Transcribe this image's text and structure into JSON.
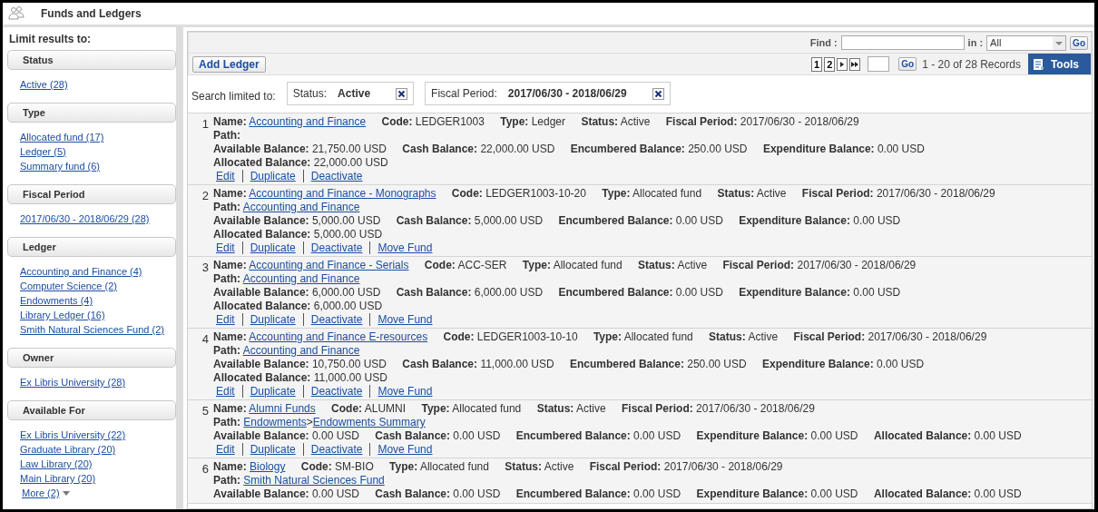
{
  "header": {
    "title": "Funds and Ledgers"
  },
  "sidebar": {
    "heading": "Limit results to:",
    "groups": [
      {
        "title": "Status",
        "items": [
          "Active (28)"
        ]
      },
      {
        "title": "Type",
        "items": [
          "Allocated fund (17)",
          "Ledger (5)",
          "Summary fund (6)"
        ]
      },
      {
        "title": "Fiscal Period",
        "items": [
          "2017/06/30 - 2018/06/29 (28)"
        ]
      },
      {
        "title": "Ledger",
        "items": [
          "Accounting and Finance (4)",
          "Computer Science (2)",
          "Endowments (4)",
          "Library Ledger (16)",
          "Smith Natural Sciences Fund (2)"
        ]
      },
      {
        "title": "Owner",
        "items": [
          "Ex Libris University (28)"
        ]
      },
      {
        "title": "Available For",
        "items": [
          "Ex Libris University (22)",
          "Graduate Library (20)",
          "Law Library (20)",
          "Main Library (20)"
        ]
      }
    ],
    "more": "More (2)"
  },
  "toolbar": {
    "find_label": "Find :",
    "in_label": "in :",
    "in_value": "All",
    "find_go": "Go",
    "add_button": "Add Ledger",
    "pages": [
      "1",
      "2"
    ],
    "page_go": "Go",
    "records": "1 - 20 of 28 Records",
    "tools": "Tools"
  },
  "filters": {
    "label": "Search limited to:",
    "chips": [
      {
        "label": "Status:",
        "value": "Active"
      },
      {
        "label": "Fiscal Period:",
        "value": "2017/06/30 - 2018/06/29"
      }
    ]
  },
  "records": [
    {
      "index": "1",
      "fields": [
        {
          "label": "Name:",
          "value": "Accounting and Finance",
          "kind": "link"
        },
        {
          "label": "Code:",
          "value": "LEDGER1003",
          "kind": "text"
        },
        {
          "label": "Type:",
          "value": "Ledger",
          "kind": "text"
        },
        {
          "label": "Status:",
          "value": "Active",
          "kind": "text"
        },
        {
          "label": "Fiscal Period:",
          "value": "2017/06/30 - 2018/06/29",
          "kind": "text"
        }
      ],
      "path_label": "Path:",
      "balances": [
        {
          "label": "Available Balance:",
          "value": "21,750.00 USD"
        },
        {
          "label": "Cash Balance:",
          "value": "22,000.00 USD"
        },
        {
          "label": "Encumbered Balance:",
          "value": "250.00 USD"
        },
        {
          "label": "Expenditure Balance:",
          "value": "0.00 USD"
        },
        {
          "label": "Allocated Balance:",
          "value": "22,000.00 USD"
        }
      ],
      "actions": [
        "Edit",
        "Duplicate",
        "Deactivate"
      ]
    },
    {
      "index": "2",
      "fields": [
        {
          "label": "Name:",
          "value": "Accounting and Finance - Monographs",
          "kind": "link"
        },
        {
          "label": "Code:",
          "value": "LEDGER1003-10-20",
          "kind": "text"
        },
        {
          "label": "Type:",
          "value": "Allocated fund",
          "kind": "text"
        },
        {
          "label": "Status:",
          "value": "Active",
          "kind": "text"
        },
        {
          "label": "Fiscal Period:",
          "value": "2017/06/30 - 2018/06/29",
          "kind": "text"
        }
      ],
      "path_label": "Path:",
      "path": [
        {
          "text": "Accounting and Finance",
          "kind": "link"
        }
      ],
      "balances": [
        {
          "label": "Available Balance:",
          "value": "5,000.00 USD"
        },
        {
          "label": "Cash Balance:",
          "value": "5,000.00 USD"
        },
        {
          "label": "Encumbered Balance:",
          "value": "0.00 USD"
        },
        {
          "label": "Expenditure Balance:",
          "value": "0.00 USD"
        },
        {
          "label": "Allocated Balance:",
          "value": "5,000.00 USD"
        }
      ],
      "actions": [
        "Edit",
        "Duplicate",
        "Deactivate",
        "Move Fund"
      ]
    },
    {
      "index": "3",
      "fields": [
        {
          "label": "Name:",
          "value": "Accounting and Finance - Serials",
          "kind": "link"
        },
        {
          "label": "Code:",
          "value": "ACC-SER",
          "kind": "text"
        },
        {
          "label": "Type:",
          "value": "Allocated fund",
          "kind": "text"
        },
        {
          "label": "Status:",
          "value": "Active",
          "kind": "text"
        },
        {
          "label": "Fiscal Period:",
          "value": "2017/06/30 - 2018/06/29",
          "kind": "text"
        }
      ],
      "path_label": "Path:",
      "path": [
        {
          "text": "Accounting and Finance",
          "kind": "link"
        }
      ],
      "balances": [
        {
          "label": "Available Balance:",
          "value": "6,000.00 USD"
        },
        {
          "label": "Cash Balance:",
          "value": "6,000.00 USD"
        },
        {
          "label": "Encumbered Balance:",
          "value": "0.00 USD"
        },
        {
          "label": "Expenditure Balance:",
          "value": "0.00 USD"
        },
        {
          "label": "Allocated Balance:",
          "value": "6,000.00 USD"
        }
      ],
      "actions": [
        "Edit",
        "Duplicate",
        "Deactivate",
        "Move Fund"
      ]
    },
    {
      "index": "4",
      "fields": [
        {
          "label": "Name:",
          "value": "Accounting and Finance E-resources",
          "kind": "link"
        },
        {
          "label": "Code:",
          "value": "LEDGER1003-10-10",
          "kind": "text"
        },
        {
          "label": "Type:",
          "value": "Allocated fund",
          "kind": "text"
        },
        {
          "label": "Status:",
          "value": "Active",
          "kind": "text"
        },
        {
          "label": "Fiscal Period:",
          "value": "2017/06/30 - 2018/06/29",
          "kind": "text"
        }
      ],
      "path_label": "Path:",
      "path": [
        {
          "text": "Accounting and Finance",
          "kind": "link"
        }
      ],
      "balances": [
        {
          "label": "Available Balance:",
          "value": "10,750.00 USD"
        },
        {
          "label": "Cash Balance:",
          "value": "11,000.00 USD"
        },
        {
          "label": "Encumbered Balance:",
          "value": "250.00 USD"
        },
        {
          "label": "Expenditure Balance:",
          "value": "0.00 USD"
        },
        {
          "label": "Allocated Balance:",
          "value": "11,000.00 USD"
        }
      ],
      "actions": [
        "Edit",
        "Duplicate",
        "Deactivate",
        "Move Fund"
      ]
    },
    {
      "index": "5",
      "fields": [
        {
          "label": "Name:",
          "value": "Alumni Funds",
          "kind": "link"
        },
        {
          "label": "Code:",
          "value": "ALUMNI",
          "kind": "text"
        },
        {
          "label": "Type:",
          "value": "Allocated fund",
          "kind": "text"
        },
        {
          "label": "Status:",
          "value": "Active",
          "kind": "text"
        },
        {
          "label": "Fiscal Period:",
          "value": "2017/06/30 - 2018/06/29",
          "kind": "text"
        }
      ],
      "path_label": "Path:",
      "path": [
        {
          "text": "Endowments",
          "kind": "link"
        },
        {
          "text": ">",
          "kind": "separator"
        },
        {
          "text": "Endowments Summary",
          "kind": "link"
        }
      ],
      "balances": [
        {
          "label": "Available Balance:",
          "value": "0.00 USD"
        },
        {
          "label": "Cash Balance:",
          "value": "0.00 USD"
        },
        {
          "label": "Encumbered Balance:",
          "value": "0.00 USD"
        },
        {
          "label": "Expenditure Balance:",
          "value": "0.00 USD"
        },
        {
          "label": "Allocated Balance:",
          "value": "0.00 USD"
        }
      ],
      "actions": [
        "Edit",
        "Duplicate",
        "Deactivate",
        "Move Fund"
      ]
    },
    {
      "index": "6",
      "fields": [
        {
          "label": "Name:",
          "value": "Biology",
          "kind": "link"
        },
        {
          "label": "Code:",
          "value": "SM-BIO",
          "kind": "text"
        },
        {
          "label": "Type:",
          "value": "Allocated fund",
          "kind": "text"
        },
        {
          "label": "Status:",
          "value": "Active",
          "kind": "text"
        },
        {
          "label": "Fiscal Period:",
          "value": "2017/06/30 - 2018/06/29",
          "kind": "text"
        }
      ],
      "path_label": "Path:",
      "path": [
        {
          "text": "Smith Natural Sciences Fund",
          "kind": "link"
        }
      ],
      "balances": [
        {
          "label": "Available Balance:",
          "value": "0.00 USD"
        },
        {
          "label": "Cash Balance:",
          "value": "0.00 USD"
        },
        {
          "label": "Encumbered Balance:",
          "value": "0.00 USD"
        },
        {
          "label": "Expenditure Balance:",
          "value": "0.00 USD"
        },
        {
          "label": "Allocated Balance:",
          "value": "0.00 USD"
        }
      ]
    }
  ]
}
